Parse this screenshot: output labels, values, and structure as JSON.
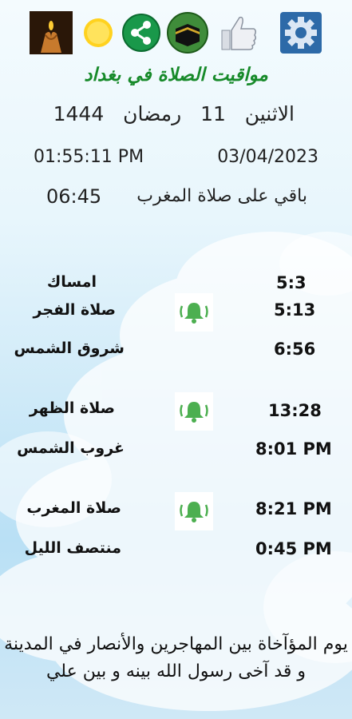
{
  "header": {
    "icons": [
      "gear-icon",
      "thumbs-up-icon",
      "kaaba-icon",
      "share-icon",
      "sun-icon",
      "praying-hands-icon"
    ],
    "title": "مواقيت الصلاة في بغداد"
  },
  "date": {
    "hijri_day_name": "الاثنين",
    "hijri_day": "11",
    "hijri_month": "رمضان",
    "hijri_year": "1444",
    "gregorian": "03/04/2023",
    "clock": "01:55:11 PM"
  },
  "countdown": {
    "label": "باقي على صلاة  المغرب",
    "value": "06:45"
  },
  "prayers": [
    {
      "name": "امساك",
      "time": "5:3",
      "has_bell": false
    },
    {
      "name": "صلاة الفجر",
      "time": "5:13",
      "has_bell": true
    },
    {
      "name": "شروق الشمس",
      "time": "6:56",
      "has_bell": false
    },
    {
      "name": "صلاة الظهر",
      "time": "13:28",
      "has_bell": true
    },
    {
      "name": "غروب الشمس",
      "time": "8:01 PM",
      "has_bell": false
    },
    {
      "name": "صلاة المغرب",
      "time": "8:21 PM",
      "has_bell": true
    },
    {
      "name": "منتصف الليل",
      "time": "0:45 PM",
      "has_bell": false
    }
  ],
  "footer": {
    "text": "يوم المؤآخاة بين المهاجرين والأنصار في المدينة و قد آخى رسول الله بينه و بين علي"
  },
  "colors": {
    "title": "#178a2a",
    "bell_bg": "#ffffff",
    "bell": "#4caf50",
    "sky_top": "#f4fbfe",
    "sky_bottom": "#b9e0f5"
  }
}
